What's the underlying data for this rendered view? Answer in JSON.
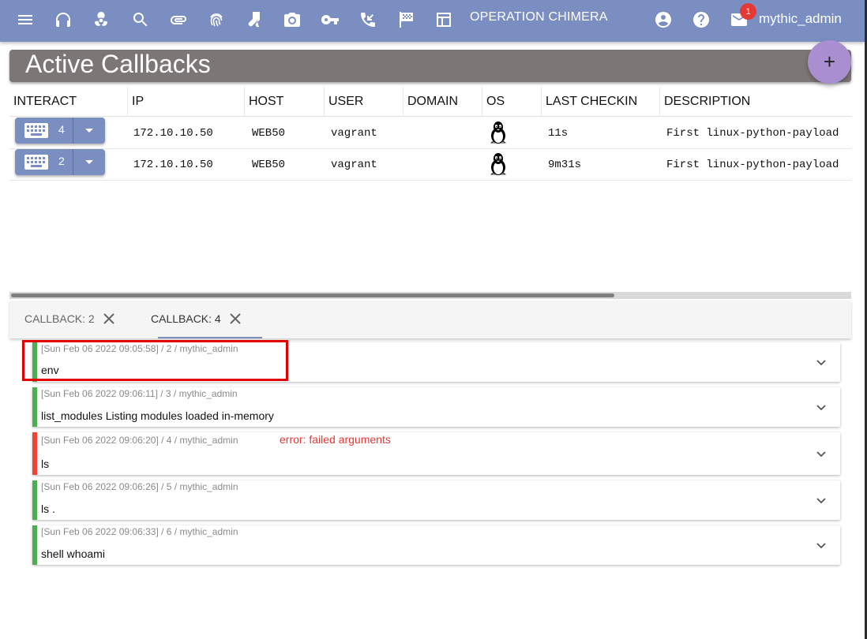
{
  "appbar": {
    "operation": "OPERATION CHIMERA",
    "notification_count": "1",
    "username": "mythic_admin",
    "color": "#7b8ec2",
    "icons": [
      "menu-icon",
      "headphones-icon",
      "biohazard-icon",
      "search-icon",
      "attachment-icon",
      "fingerprint-icon",
      "socks-icon",
      "camera-icon",
      "key-icon",
      "phone-callback-icon",
      "checkered-flag-icon",
      "table-layout-icon",
      "account-circle-icon",
      "help-icon",
      "mail-icon"
    ]
  },
  "page": {
    "title": "Active Callbacks",
    "fab_label": "+"
  },
  "table": {
    "headers": [
      "INTERACT",
      "IP",
      "HOST",
      "USER",
      "DOMAIN",
      "OS",
      "LAST CHECKIN",
      "DESCRIPTION"
    ],
    "rows": [
      {
        "id": "4",
        "ip": "172.10.10.50",
        "host": "WEB50",
        "user": "vagrant",
        "domain": "",
        "os": "linux",
        "last_checkin": "11s",
        "description": "First linux-python-payload"
      },
      {
        "id": "2",
        "ip": "172.10.10.50",
        "host": "WEB50",
        "user": "vagrant",
        "domain": "",
        "os": "linux",
        "last_checkin": "9m31s",
        "description": "First linux-python-payload"
      }
    ]
  },
  "tabs": [
    {
      "label": "CALLBACK: 2",
      "active": false
    },
    {
      "label": "CALLBACK: 4",
      "active": true
    }
  ],
  "tasks": [
    {
      "meta": "[Sun Feb 06 2022 09:05:58] / 2 / mythic_admin",
      "command": "env",
      "status": "success",
      "error": ""
    },
    {
      "meta": "[Sun Feb 06 2022 09:06:11] / 3 / mythic_admin",
      "command": "list_modules Listing modules loaded in-memory",
      "status": "success",
      "error": ""
    },
    {
      "meta": "[Sun Feb 06 2022 09:06:20] / 4 / mythic_admin",
      "command": "ls",
      "status": "error",
      "error": "error: failed arguments"
    },
    {
      "meta": "[Sun Feb 06 2022 09:06:26] / 5 / mythic_admin",
      "command": "ls .",
      "status": "success",
      "error": ""
    },
    {
      "meta": "[Sun Feb 06 2022 09:06:33] / 6 / mythic_admin",
      "command": "shell whoami",
      "status": "success",
      "error": ""
    }
  ],
  "colors": {
    "success": "#4caf50",
    "error": "#f44336",
    "header": "#7c7676"
  }
}
